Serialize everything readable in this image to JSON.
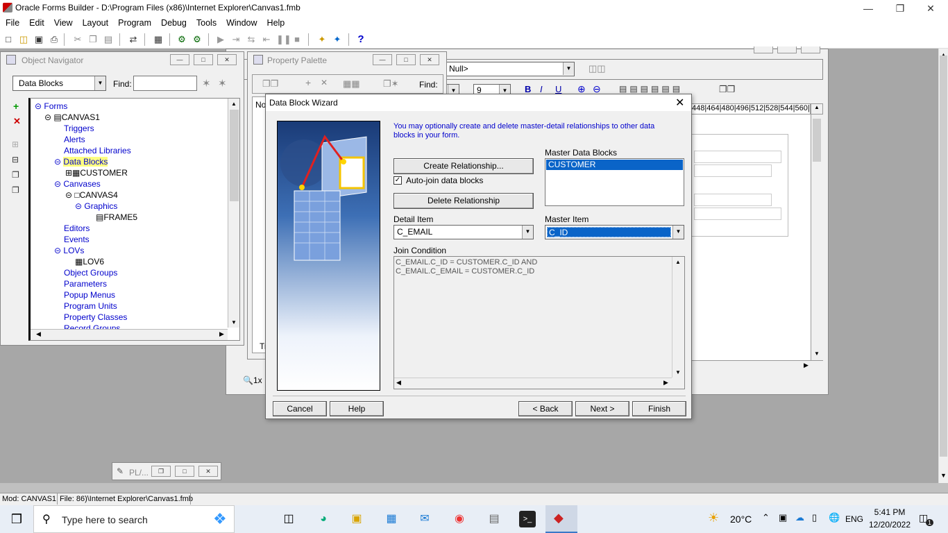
{
  "app": {
    "title": "Oracle Forms Builder - D:\\Program Files (x86)\\Internet Explorer\\Canvas1.fmb",
    "menu": [
      "File",
      "Edit",
      "View",
      "Layout",
      "Program",
      "Debug",
      "Tools",
      "Window",
      "Help"
    ]
  },
  "navigator": {
    "title": "Object Navigator",
    "dropdown_value": "Data Blocks",
    "find_label": "Find:",
    "tree": [
      "Forms",
      "CANVAS1",
      "Triggers",
      "Alerts",
      "Attached Libraries",
      "Data Blocks",
      "CUSTOMER",
      "Canvases",
      "CANVAS4",
      "Graphics",
      "FRAME5",
      "Editors",
      "Events",
      "LOVs",
      "LOV6",
      "Object Groups",
      "Parameters",
      "Popup Menus",
      "Program Units",
      "Property Classes",
      "Record Groups"
    ]
  },
  "palette": {
    "title": "Property Palette",
    "find_label": "Find:",
    "peek_text": "No",
    "peek_bottom": "Tr"
  },
  "layout_editor": {
    "null_value": "Null>",
    "font_size": "9",
    "ruler": "448|464|480|496|512|528|544|560|",
    "zoom": "1x"
  },
  "wizard": {
    "title": "Data Block Wizard",
    "intro": "You may optionally create and delete master-detail relationships to other data blocks in your form.",
    "master_blocks_label": "Master Data Blocks",
    "master_blocks": [
      "CUSTOMER"
    ],
    "create_btn": "Create Relationship...",
    "autojoin_label": "Auto-join data blocks",
    "delete_btn": "Delete Relationship",
    "detail_item_label": "Detail Item",
    "detail_item_value": "C_EMAIL",
    "master_item_label": "Master Item",
    "master_item_value": "C_ID",
    "join_label": "Join Condition",
    "join_text_1": "C_EMAIL.C_ID = CUSTOMER.C_ID AND",
    "join_text_2": "C_EMAIL.C_EMAIL = CUSTOMER.C_ID",
    "cancel": "Cancel",
    "help": "Help",
    "back": "< Back",
    "next": "Next >",
    "finish": "Finish"
  },
  "minimized": {
    "label": "PL/..."
  },
  "status": {
    "mod": "Mod: CANVAS1",
    "file": "File: 86)\\Internet Explorer\\Canvas1.fmb"
  },
  "taskbar": {
    "search_placeholder": "Type here to search",
    "weather": "20°C",
    "lang": "ENG",
    "time": "5:41 PM",
    "date": "12/20/2022",
    "notif_count": "1"
  }
}
